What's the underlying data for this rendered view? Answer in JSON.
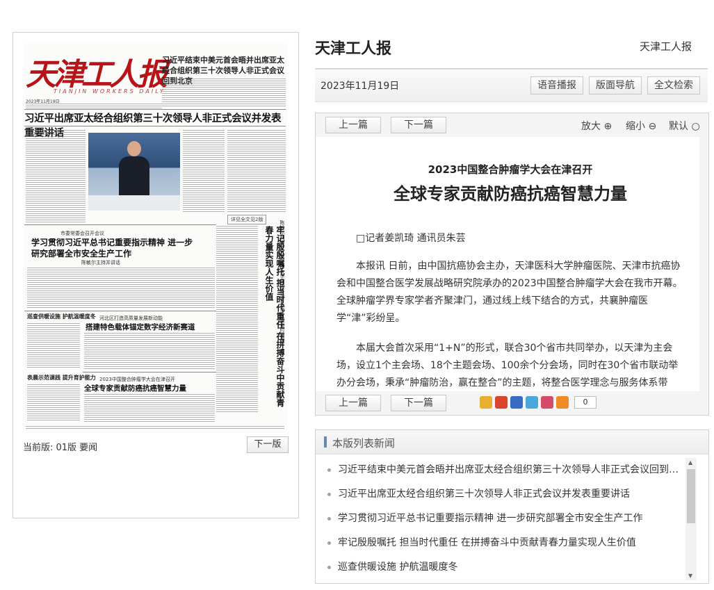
{
  "epaper": {
    "masthead": "天津工人报",
    "masthead_en": "TIANJIN WORKERS DAILY",
    "masthead_date": "2023年11月19日",
    "masthead_day": "19",
    "headline_top": "习近平结束中美元首会晤并出席亚太经合组织第三十次领导人非正式会议回到北京",
    "lead_headline": "习近平出席亚太经合组织第三十次领导人非正式会议并发表重要讲话",
    "photo_caption_link": "详见全文见2版",
    "sec2_sub": "市委常委会召开会议",
    "sec2_title": "学习贯彻习近平总书记重要指示精神 进一步研究部署全市安全生产工作",
    "sec2_by": "陈敏尔主持并讲话",
    "vertical_title": "牢记殷殷嘱托 担当时代重任 在拼搏奋斗中贡献青春力量实现人生价值",
    "vertical_sub": "陈敏尔到南开大学天津大学调研并与青年学生座谈时强调",
    "box1_title": "巡查供暖设施 护航温暖度冬",
    "box2_title": "表晨示范课践 提升育护能力",
    "sec3_sub": "河北区打造高质量发展新动能",
    "sec3_title": "搭建特色载体锚定数字经济新赛道",
    "sec4_sub": "2023中国整合肿瘤学大会在津召开",
    "sec4_title": "全球专家贡献防癌抗癌智慧力量",
    "current_edition": "当前版: 01版 要闻",
    "next_edition": "下一版"
  },
  "header": {
    "paper_name": "天津工人报",
    "paper_name_right": "天津工人报"
  },
  "toolbar": {
    "date": "2023年11月19日",
    "voice_btn": "语音播报",
    "nav_btn": "版面导航",
    "search_btn": "全文检索"
  },
  "article": {
    "prev": "上一篇",
    "next": "下一篇",
    "zoom_in": "放大 ⊕",
    "zoom_out": "缩小 ⊖",
    "zoom_default": "默认 ○",
    "kicker": "2023中国整合肿瘤学大会在津召开",
    "headline": "全球专家贡献防癌抗癌智慧力量",
    "byline": "□记者姜凯琦 通讯员朱芸",
    "para1": "本报讯 日前，由中国抗癌协会主办，天津医科大学肿瘤医院、天津市抗癌协会和中国整合医学发展战略研究院承办的2023中国整合肿瘤学大会在我市开幕。全球肿瘤学界专家学者齐聚津门，通过线上线下结合的方式，共襄肿瘤医学“津”彩纷呈。",
    "para2": "本届大会首次采用“1+N”的形式，联合30个省市共同举办，以天津为主会场，设立1个主会场、18个主题会场、100余个分会场，同时在30个省市联动举办分会场，秉承“肿瘤防治，赢在整合”的主题，将整合医学理念与服务体系带",
    "share_count": "0"
  },
  "news_list": {
    "title": "本版列表新闻",
    "items": [
      "习近平结束中美元首会晤并出席亚太经合组织第三十次领导人非正式会议回到北京",
      "习近平出席亚太经合组织第三十次领导人非正式会议并发表重要讲话",
      "学习贯彻习近平总书记重要指示精神 进一步研究部署全市安全生产工作",
      "牢记殷殷嘱托 担当时代重任 在拼搏奋斗中贡献青春力量实现人生价值",
      "巡查供暖设施 护航温暖度冬"
    ]
  }
}
